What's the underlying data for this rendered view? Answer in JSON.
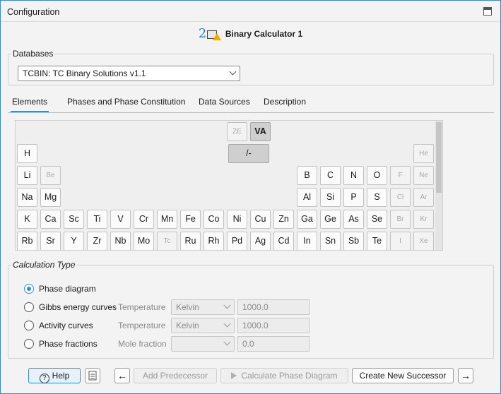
{
  "window": {
    "title": "Configuration"
  },
  "header": {
    "calculator_name": "Binary Calculator 1"
  },
  "databases": {
    "legend": "Databases",
    "selected": "TCBIN: TC  Binary Solutions  v1.1"
  },
  "tabs": [
    {
      "label": "Elements",
      "active": true
    },
    {
      "label": "Phases and Phase Constitution",
      "active": false
    },
    {
      "label": "Data Sources",
      "active": false
    },
    {
      "label": "Description",
      "active": false
    }
  ],
  "periodic_table": {
    "special": {
      "ze": "ZE",
      "va": "VA",
      "slash": "/-"
    },
    "rows": [
      [
        "H",
        "He"
      ],
      [
        "Li",
        "Be",
        "B",
        "C",
        "N",
        "O",
        "F",
        "Ne"
      ],
      [
        "Na",
        "Mg",
        "Al",
        "Si",
        "P",
        "S",
        "Cl",
        "Ar"
      ],
      [
        "K",
        "Ca",
        "Sc",
        "Ti",
        "V",
        "Cr",
        "Mn",
        "Fe",
        "Co",
        "Ni",
        "Cu",
        "Zn",
        "Ga",
        "Ge",
        "As",
        "Se",
        "Br",
        "Kr"
      ],
      [
        "Rb",
        "Sr",
        "Y",
        "Zr",
        "Nb",
        "Mo",
        "Tc",
        "Ru",
        "Rh",
        "Pd",
        "Ag",
        "Cd",
        "In",
        "Sn",
        "Sb",
        "Te",
        "I",
        "Xe"
      ]
    ]
  },
  "calculation_type": {
    "legend": "Calculation Type",
    "options": [
      {
        "label": "Phase diagram",
        "selected": true
      },
      {
        "label": "Gibbs energy curves",
        "selected": false,
        "param": "Temperature",
        "unit": "Kelvin",
        "value": "1000.0"
      },
      {
        "label": "Activity curves",
        "selected": false,
        "param": "Temperature",
        "unit": "Kelvin",
        "value": "1000.0"
      },
      {
        "label": "Phase fractions",
        "selected": false,
        "param": "Mole fraction",
        "unit": "",
        "value": "0.0"
      }
    ]
  },
  "buttons": {
    "help": "Help",
    "add_predecessor": "Add Predecessor",
    "calculate": "Calculate Phase Diagram",
    "create_successor": "Create New Successor",
    "back_arrow": "←",
    "forward_arrow": "→"
  }
}
